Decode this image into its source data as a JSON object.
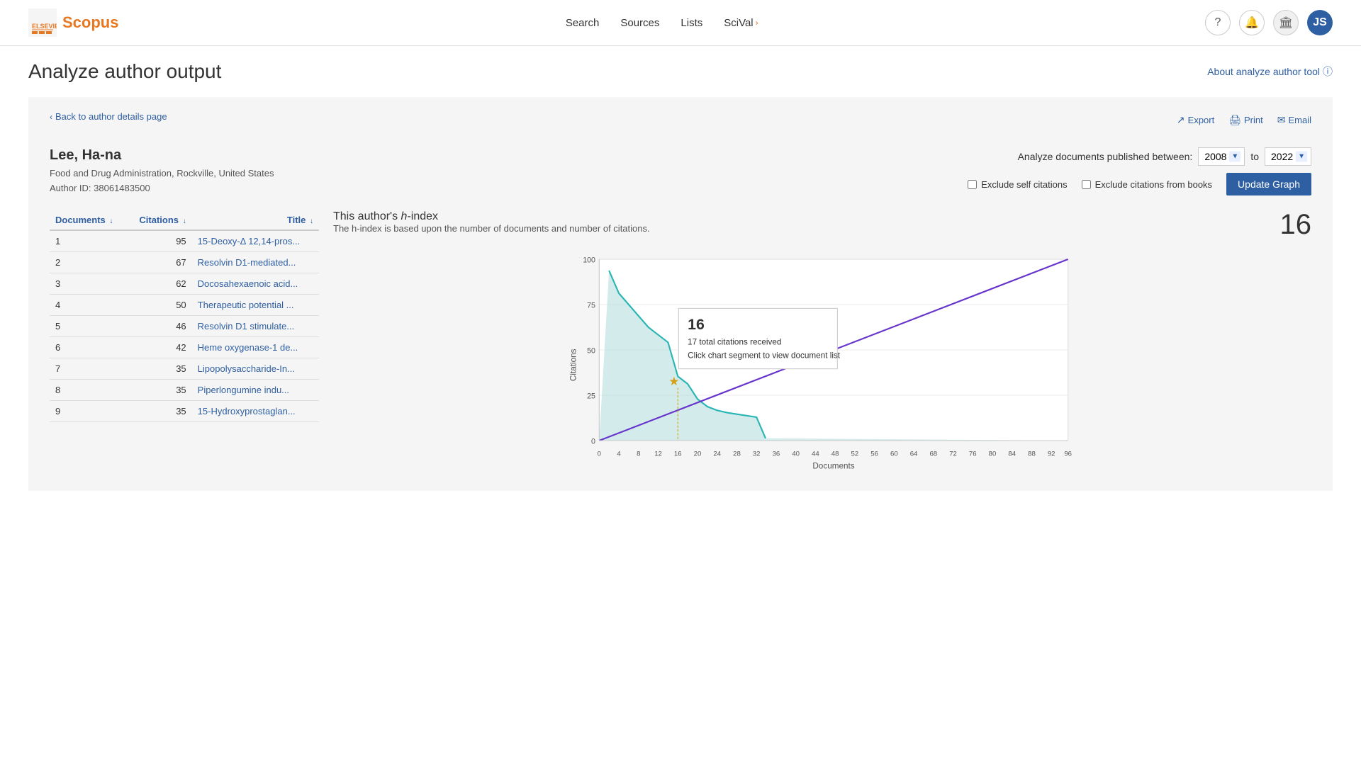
{
  "header": {
    "logo_text": "Scopus",
    "nav": {
      "search": "Search",
      "sources": "Sources",
      "lists": "Lists",
      "scival": "SciVal",
      "scival_arrow": "›"
    },
    "icons": {
      "help": "?",
      "notifications": "🔔",
      "institution": "🏛",
      "user_initials": "JS"
    }
  },
  "page_title": "Analyze author output",
  "about_link": "About analyze author tool",
  "back_link": "Back to author details page",
  "actions": {
    "export": "Export",
    "print": "Print",
    "email": "Email"
  },
  "author": {
    "name": "Lee, Ha-na",
    "affiliation": "Food and Drug Administration, Rockville, United States",
    "author_id_label": "Author ID:",
    "author_id": "38061483500"
  },
  "controls": {
    "analyze_label": "Analyze documents published between:",
    "from_year": "2008",
    "to_label": "to",
    "to_year": "2022",
    "exclude_self": "Exclude self citations",
    "exclude_books": "Exclude citations from books",
    "update_btn": "Update Graph"
  },
  "table": {
    "columns": [
      "Documents ↓",
      "Citations ↓",
      "Title ↓"
    ],
    "rows": [
      {
        "num": "1",
        "citations": "95",
        "title": "15-Deoxy-Δ 12,14-pros..."
      },
      {
        "num": "2",
        "citations": "67",
        "title": "Resolvin D1-mediated..."
      },
      {
        "num": "3",
        "citations": "62",
        "title": "Docosahexaenoic acid..."
      },
      {
        "num": "4",
        "citations": "50",
        "title": "Therapeutic potential ..."
      },
      {
        "num": "5",
        "citations": "46",
        "title": "Resolvin D1 stimulate..."
      },
      {
        "num": "6",
        "citations": "42",
        "title": "Heme oxygenase-1 de..."
      },
      {
        "num": "7",
        "citations": "35",
        "title": "Lipopolysaccharide-In..."
      },
      {
        "num": "8",
        "citations": "35",
        "title": "Piperlongumine indu..."
      },
      {
        "num": "9",
        "citations": "35",
        "title": "15-Hydroxyprostaglan..."
      }
    ]
  },
  "chart": {
    "title": "This author's h-index",
    "h_italic": "h",
    "h_index_value": "16",
    "subtitle": "The h-index is based upon the number of documents and number of citations.",
    "x_axis_label": "Documents",
    "y_axis_label": "Citations",
    "x_ticks": [
      "0",
      "4",
      "8",
      "12",
      "16",
      "20",
      "24",
      "28",
      "32",
      "36",
      "40",
      "44",
      "48",
      "52",
      "56",
      "60",
      "64",
      "68",
      "72",
      "76",
      "80",
      "84",
      "88",
      "92",
      "96"
    ],
    "y_ticks": [
      "0",
      "25",
      "50",
      "75",
      "100"
    ],
    "tooltip": {
      "value": "16",
      "line1": "17 total citations received",
      "line2": "Click chart segment to view document list"
    }
  }
}
